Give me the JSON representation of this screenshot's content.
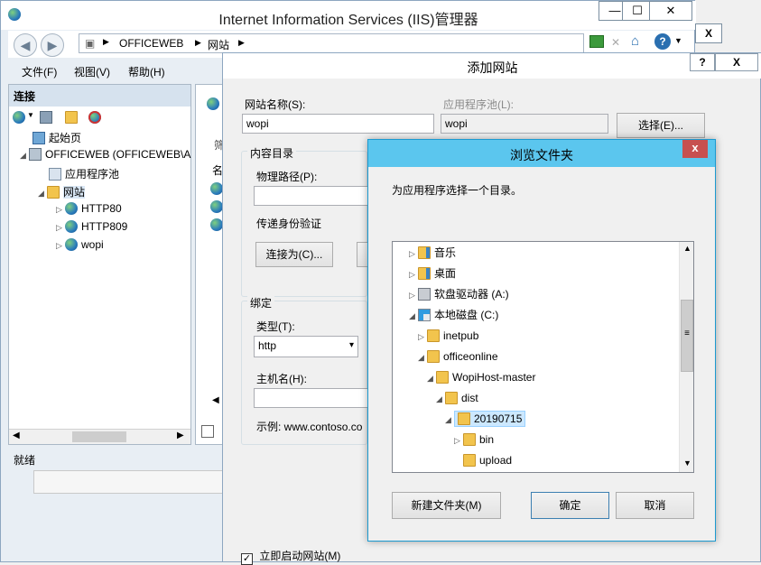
{
  "iis": {
    "title": "Internet Information Services (IIS)管理器",
    "window_buttons": [
      "—",
      "☐",
      "✕"
    ],
    "address": [
      "OFFICEWEB",
      "网站"
    ],
    "menus": [
      "文件(F)",
      "视图(V)",
      "帮助(H)"
    ],
    "connections_header": "连接",
    "tree": [
      {
        "label": "起始页",
        "icon": "start-page-icon"
      },
      {
        "label": "OFFICEWEB (OFFICEWEB\\A",
        "icon": "server-icon"
      },
      {
        "label": "应用程序池",
        "icon": "app-pool-icon"
      },
      {
        "label": "网站",
        "icon": "folder-icon"
      },
      {
        "label": "HTTP80",
        "icon": "globe-icon"
      },
      {
        "label": "HTTP809",
        "icon": "globe-icon"
      },
      {
        "label": "wopi",
        "icon": "globe-icon"
      }
    ],
    "mid_fragments": [
      "筛",
      "名"
    ],
    "status": "就绪"
  },
  "add_site": {
    "title": "添加网站",
    "help_btn": "?",
    "close_btn": "X",
    "site_name_label": "网站名称(S):",
    "site_name_value": "wopi",
    "app_pool_label": "应用程序池(L):",
    "app_pool_value": "wopi",
    "select_btn": "选择(E)...",
    "content_dir_label": "内容目录",
    "physical_path_label": "物理路径(P):",
    "physical_path_value": "",
    "pass_auth_label": "传递身份验证",
    "connect_as_btn": "连接为(C)...",
    "binding_label": "绑定",
    "type_label": "类型(T):",
    "type_value": "http",
    "host_label": "主机名(H):",
    "host_value": "",
    "example_text": "示例: www.contoso.co",
    "start_now_label": "立即启动网站(M)",
    "start_now_checked": true
  },
  "browse": {
    "title": "浏览文件夹",
    "close_btn": "x",
    "prompt": "为应用程序选择一个目录。",
    "items": [
      {
        "label": "音乐",
        "indent": 0
      },
      {
        "label": "桌面",
        "indent": 0
      },
      {
        "label": "软盘驱动器 (A:)",
        "indent": 0
      },
      {
        "label": "本地磁盘 (C:)",
        "indent": 0
      },
      {
        "label": "inetpub",
        "indent": 1
      },
      {
        "label": "officeonline",
        "indent": 1
      },
      {
        "label": "WopiHost-master",
        "indent": 2
      },
      {
        "label": "dist",
        "indent": 3
      },
      {
        "label": "20190715",
        "indent": 4,
        "selected": true
      },
      {
        "label": "bin",
        "indent": 5
      },
      {
        "label": "upload",
        "indent": 5
      }
    ],
    "new_folder_btn": "新建文件夹(M)",
    "ok_btn": "确定",
    "cancel_btn": "取消"
  }
}
